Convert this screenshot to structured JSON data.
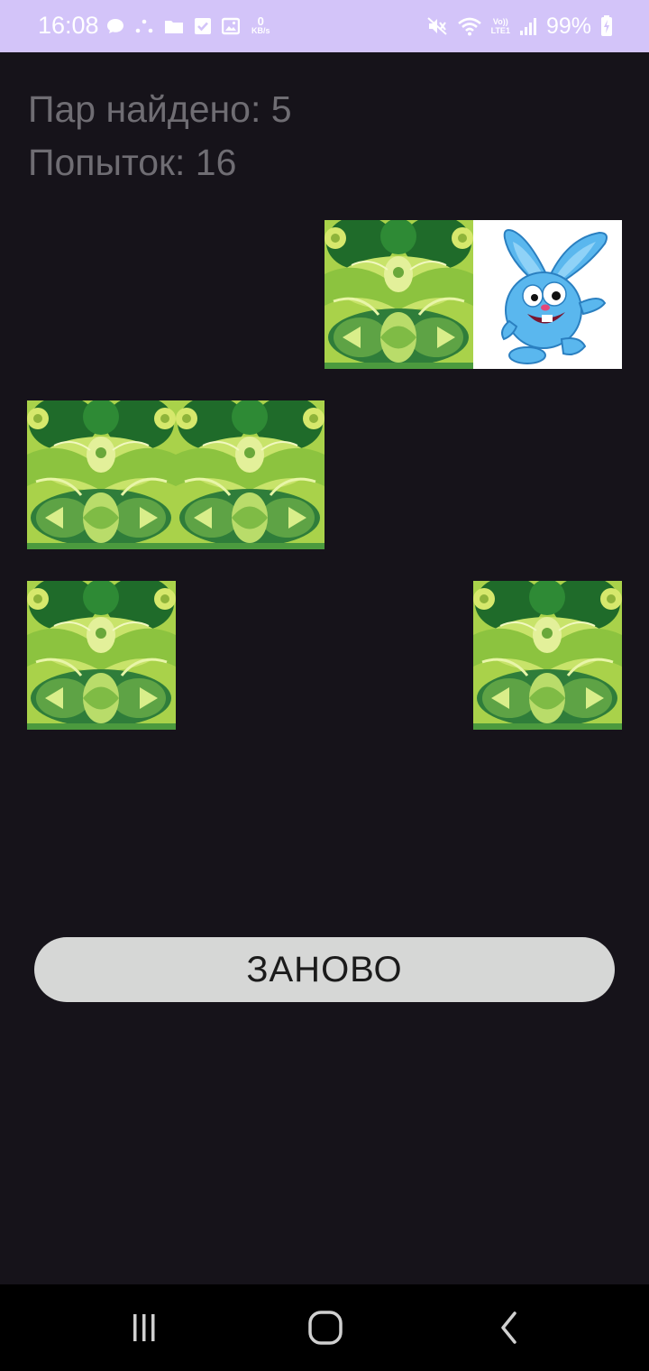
{
  "status_bar": {
    "time": "16:08",
    "left_icons": [
      "chat-bubble-icon",
      "dots-icon",
      "folder-icon",
      "check-box-icon",
      "image-icon"
    ],
    "net_speed_value": "0",
    "net_speed_unit": "KB/s",
    "volte_line1": "Vo))",
    "volte_line2": "LTE1",
    "right_icons": [
      "mute-icon",
      "wifi-icon",
      "signal-icon",
      "battery-icon"
    ],
    "battery": "99%"
  },
  "game": {
    "pairs_found": "Пар найдено: 5",
    "attempts": "Попыток: 16"
  },
  "board": {
    "cards": [
      {
        "row": 1,
        "col": 3,
        "state": "face-down"
      },
      {
        "row": 1,
        "col": 4,
        "state": "face-up",
        "image": "rabbit-icon"
      },
      {
        "row": 2,
        "col": 1,
        "state": "face-down"
      },
      {
        "row": 2,
        "col": 2,
        "state": "face-down"
      },
      {
        "row": 3,
        "col": 1,
        "state": "face-down"
      },
      {
        "row": 3,
        "col": 4,
        "state": "face-down"
      }
    ]
  },
  "restart_button": {
    "label": "ЗАНОВО"
  },
  "colors": {
    "background": "#16131a",
    "status_bar": "#d3c4f9",
    "counter_text": "#6f6d73",
    "button_bg": "#d6d7d6",
    "button_text": "#1b1b1b",
    "card_back_green": "#3d8a2a"
  },
  "nav_bar": {
    "icons": [
      "recents-icon",
      "home-icon",
      "back-icon"
    ]
  }
}
